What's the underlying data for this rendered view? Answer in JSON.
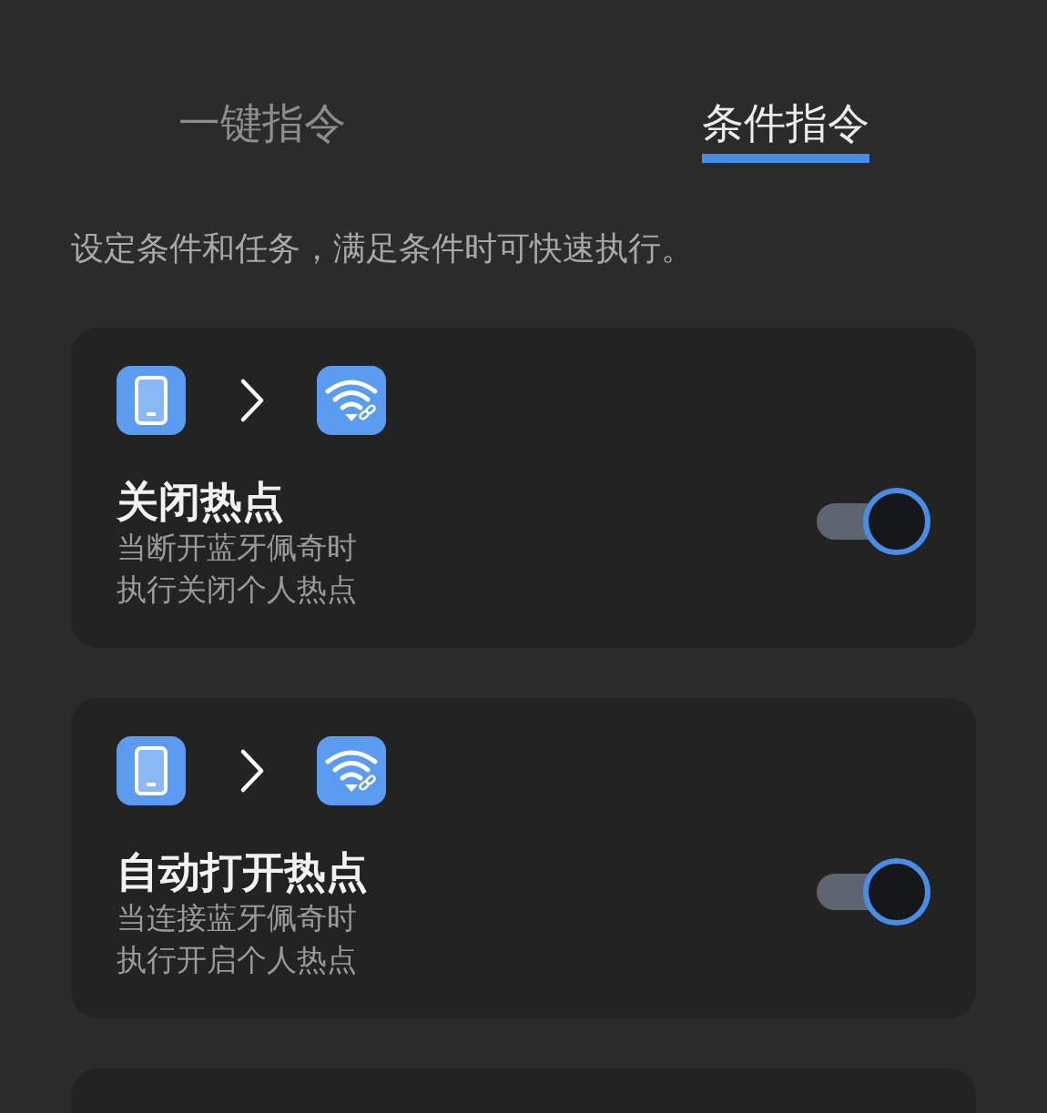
{
  "tabs": [
    {
      "label": "一键指令",
      "selected": false
    },
    {
      "label": "条件指令",
      "selected": true
    }
  ],
  "description": "设定条件和任务，满足条件时可快速执行。",
  "commands": [
    {
      "title": "关闭热点",
      "lines": [
        "当断开蓝牙佩奇时",
        "执行关闭个人热点"
      ],
      "on": true
    },
    {
      "title": "自动打开热点",
      "lines": [
        "当连接蓝牙佩奇时",
        "执行开启个人热点"
      ],
      "on": true
    }
  ]
}
